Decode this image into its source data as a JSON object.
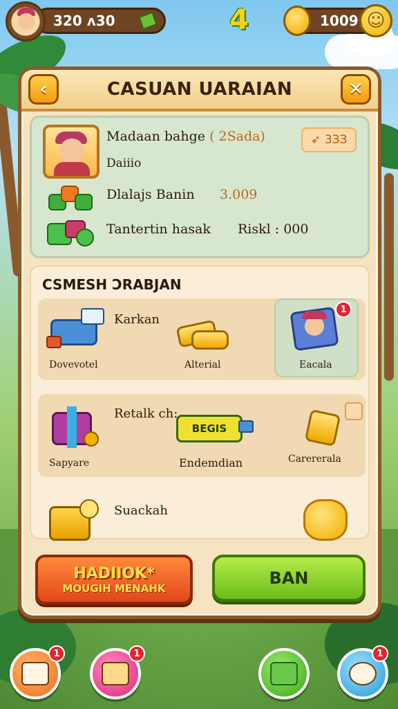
{
  "hud": {
    "currency_left": "320 ʌ30",
    "level_badge": "4",
    "coins": "1009"
  },
  "dialog": {
    "title": "CASUAN UARAIAN",
    "back_icon": "arrow-left-icon",
    "close_icon": "close-icon"
  },
  "info": {
    "name": "Madaan bahge",
    "name_suffix": "( 2Sada)",
    "tag": "3ЗЗ",
    "subtitle": "Daiiio",
    "row1_label": "Dlalajs Banin",
    "row1_value": "3.009",
    "row2_label": "Tantertin hasak",
    "row2_value": "Riskl : 000"
  },
  "shop": {
    "title": "CSMESH ƆRABJAN",
    "row1": {
      "side_label": "Karkan",
      "items": [
        {
          "label": "Dovevotel",
          "icon": "cash-register-icon"
        },
        {
          "label": "Alterial",
          "icon": "gold-bars-icon"
        },
        {
          "label": "Eacala",
          "icon": "character-card-icon",
          "badge": "1"
        }
      ]
    },
    "row2": {
      "side_label": "Retalk ch:",
      "items": [
        {
          "label": "Sapyare",
          "icon": "gift-box-icon"
        },
        {
          "label": "Endemdian",
          "icon": "ticket-icon",
          "button_text": "BEGIS"
        },
        {
          "label": "Carererala",
          "icon": "card-sparkle-icon"
        }
      ]
    },
    "row3": {
      "side_label": "Suackah",
      "items": [
        {
          "label": "",
          "icon": "chest-icon"
        },
        {
          "label": "",
          "icon": "happy-star-icon"
        }
      ]
    }
  },
  "buttons": {
    "left_line1": "HADIIOK*",
    "left_line2": "MOUGIH MENAHK",
    "right": "BAN"
  },
  "nav": [
    {
      "icon": "home-icon",
      "badge": "1"
    },
    {
      "icon": "mail-icon",
      "badge": "1"
    },
    {
      "icon": "chat-icon",
      "badge": ""
    },
    {
      "icon": "pet-icon",
      "badge": "1"
    }
  ],
  "colors": {
    "panel_border": "#8b5a2b",
    "cta_left": "#e2471b",
    "cta_right": "#6cbd1a",
    "badge": "#e3262e"
  }
}
